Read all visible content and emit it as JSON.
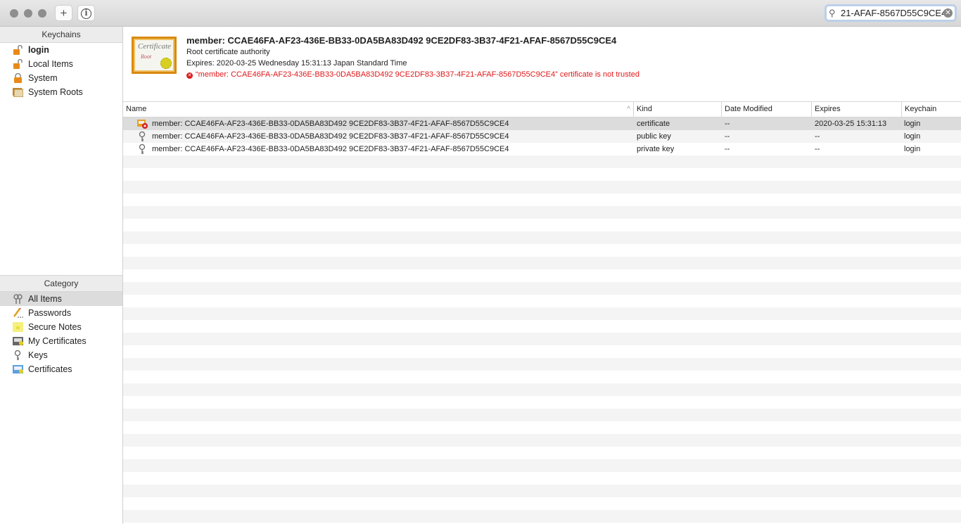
{
  "toolbar": {
    "add_label": "+",
    "info_label": "i",
    "search_value": "21-AFAF-8567D55C9CE4"
  },
  "sidebar": {
    "keychains_header": "Keychains",
    "keychains": [
      {
        "label": "login",
        "icon": "unlocked-padlock-icon"
      },
      {
        "label": "Local Items",
        "icon": "unlocked-padlock-icon"
      },
      {
        "label": "System",
        "icon": "locked-padlock-icon"
      },
      {
        "label": "System Roots",
        "icon": "certificates-folder-icon"
      }
    ],
    "category_header": "Category",
    "categories": [
      {
        "label": "All Items",
        "icon": "keys-icon"
      },
      {
        "label": "Passwords",
        "icon": "pencil-icon"
      },
      {
        "label": "Secure Notes",
        "icon": "note-icon"
      },
      {
        "label": "My Certificates",
        "icon": "my-certificate-icon"
      },
      {
        "label": "Keys",
        "icon": "key-icon"
      },
      {
        "label": "Certificates",
        "icon": "certificate-icon"
      }
    ]
  },
  "detail": {
    "cert_image_text": "Certificate Root",
    "title": "member: CCAE46FA-AF23-436E-BB33-0DA5BA83D492 9CE2DF83-3B37-4F21-AFAF-8567D55C9CE4",
    "subtitle": "Root certificate authority",
    "expires": "Expires: 2020-03-25 Wednesday 15:31:13 Japan Standard Time",
    "warning": "“member: CCAE46FA-AF23-436E-BB33-0DA5BA83D492 9CE2DF83-3B37-4F21-AFAF-8567D55C9CE4” certificate is not trusted",
    "warning_color": "#e0191b"
  },
  "table": {
    "columns": [
      "Name",
      "Kind",
      "Date Modified",
      "Expires",
      "Keychain"
    ],
    "rows": [
      {
        "name": "member: CCAE46FA-AF23-436E-BB33-0DA5BA83D492 9CE2DF83-3B37-4F21-AFAF-8567D55C9CE4",
        "kind": "certificate",
        "modified": "--",
        "expires": "2020-03-25 15:31:13",
        "keychain": "login"
      },
      {
        "name": "member: CCAE46FA-AF23-436E-BB33-0DA5BA83D492 9CE2DF83-3B37-4F21-AFAF-8567D55C9CE4",
        "kind": "public key",
        "modified": "--",
        "expires": "--",
        "keychain": "login"
      },
      {
        "name": "member: CCAE46FA-AF23-436E-BB33-0DA5BA83D492 9CE2DF83-3B37-4F21-AFAF-8567D55C9CE4",
        "kind": "private key",
        "modified": "--",
        "expires": "--",
        "keychain": "login"
      }
    ]
  }
}
